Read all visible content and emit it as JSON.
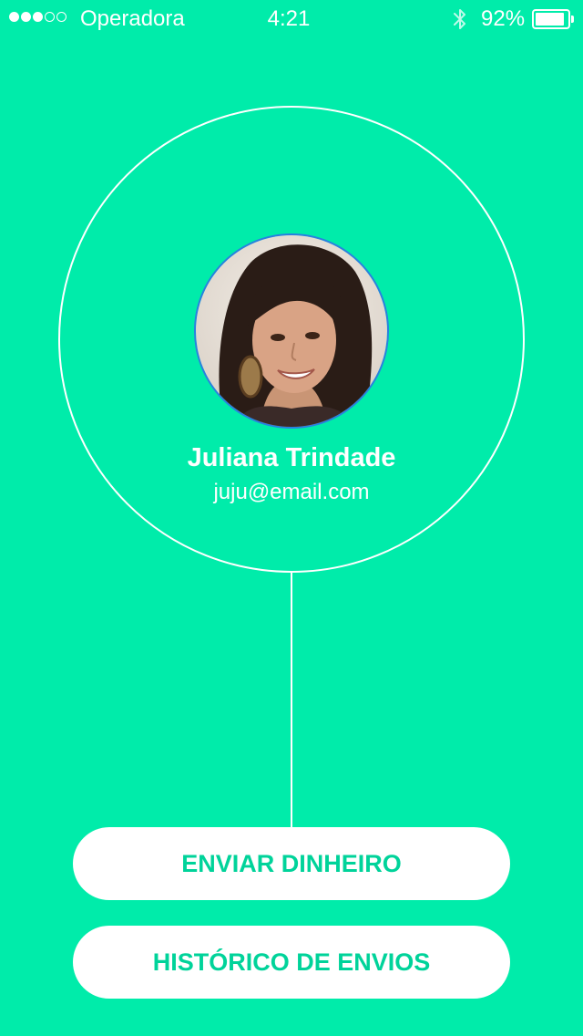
{
  "theme": {
    "background": "#00ECAA",
    "accent_text": "#00D39A",
    "foreground": "#FFFFFF",
    "avatar_border": "#2A7FE0"
  },
  "status_bar": {
    "signal_bars_filled": 3,
    "signal_bars_total": 5,
    "carrier": "Operadora",
    "time": "4:21",
    "bluetooth_icon": "bluetooth-icon",
    "battery_level": "92%",
    "battery_fraction": 0.92,
    "battery_icon": "battery-icon"
  },
  "profile": {
    "avatar_icon": "user-photo",
    "name": "Juliana Trindade",
    "email": "juju@email.com"
  },
  "actions": {
    "send_money_label": "ENVIAR DINHEIRO",
    "history_label": "HISTÓRICO DE ENVIOS"
  }
}
